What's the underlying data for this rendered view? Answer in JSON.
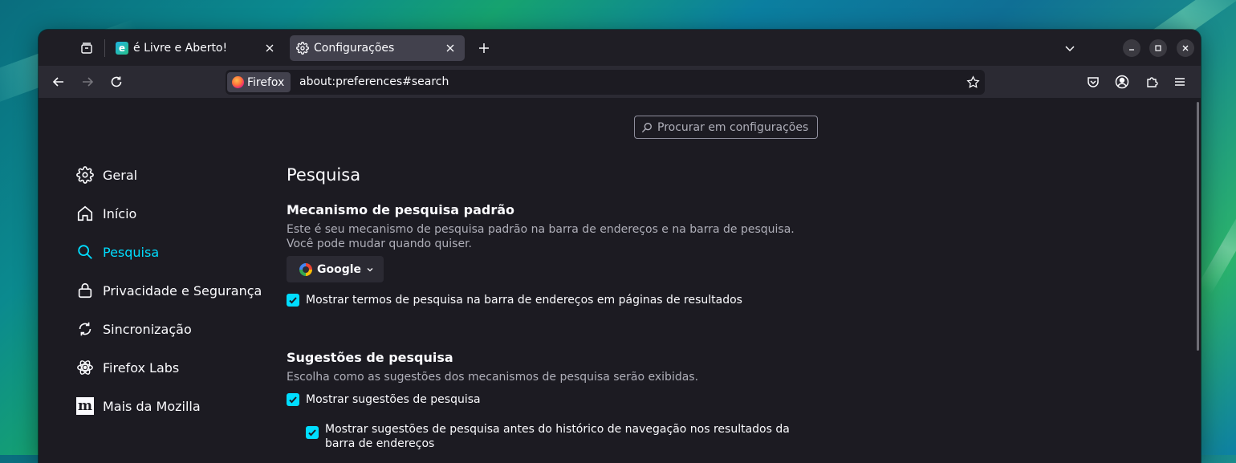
{
  "tabs": [
    {
      "label": "é Livre e Aberto!",
      "active": false,
      "favicon": "site-e-icon"
    },
    {
      "label": "Configurações",
      "active": true,
      "favicon": "gear-icon"
    }
  ],
  "navbar": {
    "identity_label": "Firefox",
    "url": "about:preferences#search"
  },
  "prefs_search": {
    "placeholder": "Procurar em configurações"
  },
  "sidebar": {
    "items": [
      {
        "label": "Geral",
        "icon": "gear-icon"
      },
      {
        "label": "Início",
        "icon": "home-icon"
      },
      {
        "label": "Pesquisa",
        "icon": "search-icon",
        "selected": true
      },
      {
        "label": "Privacidade e Segurança",
        "icon": "lock-icon"
      },
      {
        "label": "Sincronização",
        "icon": "sync-icon"
      },
      {
        "label": "Firefox Labs",
        "icon": "atom-icon"
      },
      {
        "label": "Mais da Mozilla",
        "icon": "mozilla-icon"
      }
    ]
  },
  "main": {
    "title": "Pesquisa",
    "default_engine": {
      "heading": "Mecanismo de pesquisa padrão",
      "description": "Este é seu mecanismo de pesquisa padrão na barra de endereços e na barra de pesquisa. Você pode mudar quando quiser.",
      "selected": "Google",
      "show_terms_label": "Mostrar termos de pesquisa na barra de endereços em páginas de resultados",
      "show_terms_checked": true
    },
    "suggestions": {
      "heading": "Sugestões de pesquisa",
      "description": "Escolha como as sugestões dos mecanismos de pesquisa serão exibidas.",
      "show_suggestions_label": "Mostrar sugestões de pesquisa",
      "show_suggestions_checked": true,
      "before_history_label": "Mostrar sugestões de pesquisa antes do histórico de navegação nos resultados da barra de endereços",
      "before_history_checked": true
    }
  },
  "colors": {
    "accent": "#00ddff",
    "background": "#1c1b22",
    "toolbar": "#2b2a33"
  }
}
